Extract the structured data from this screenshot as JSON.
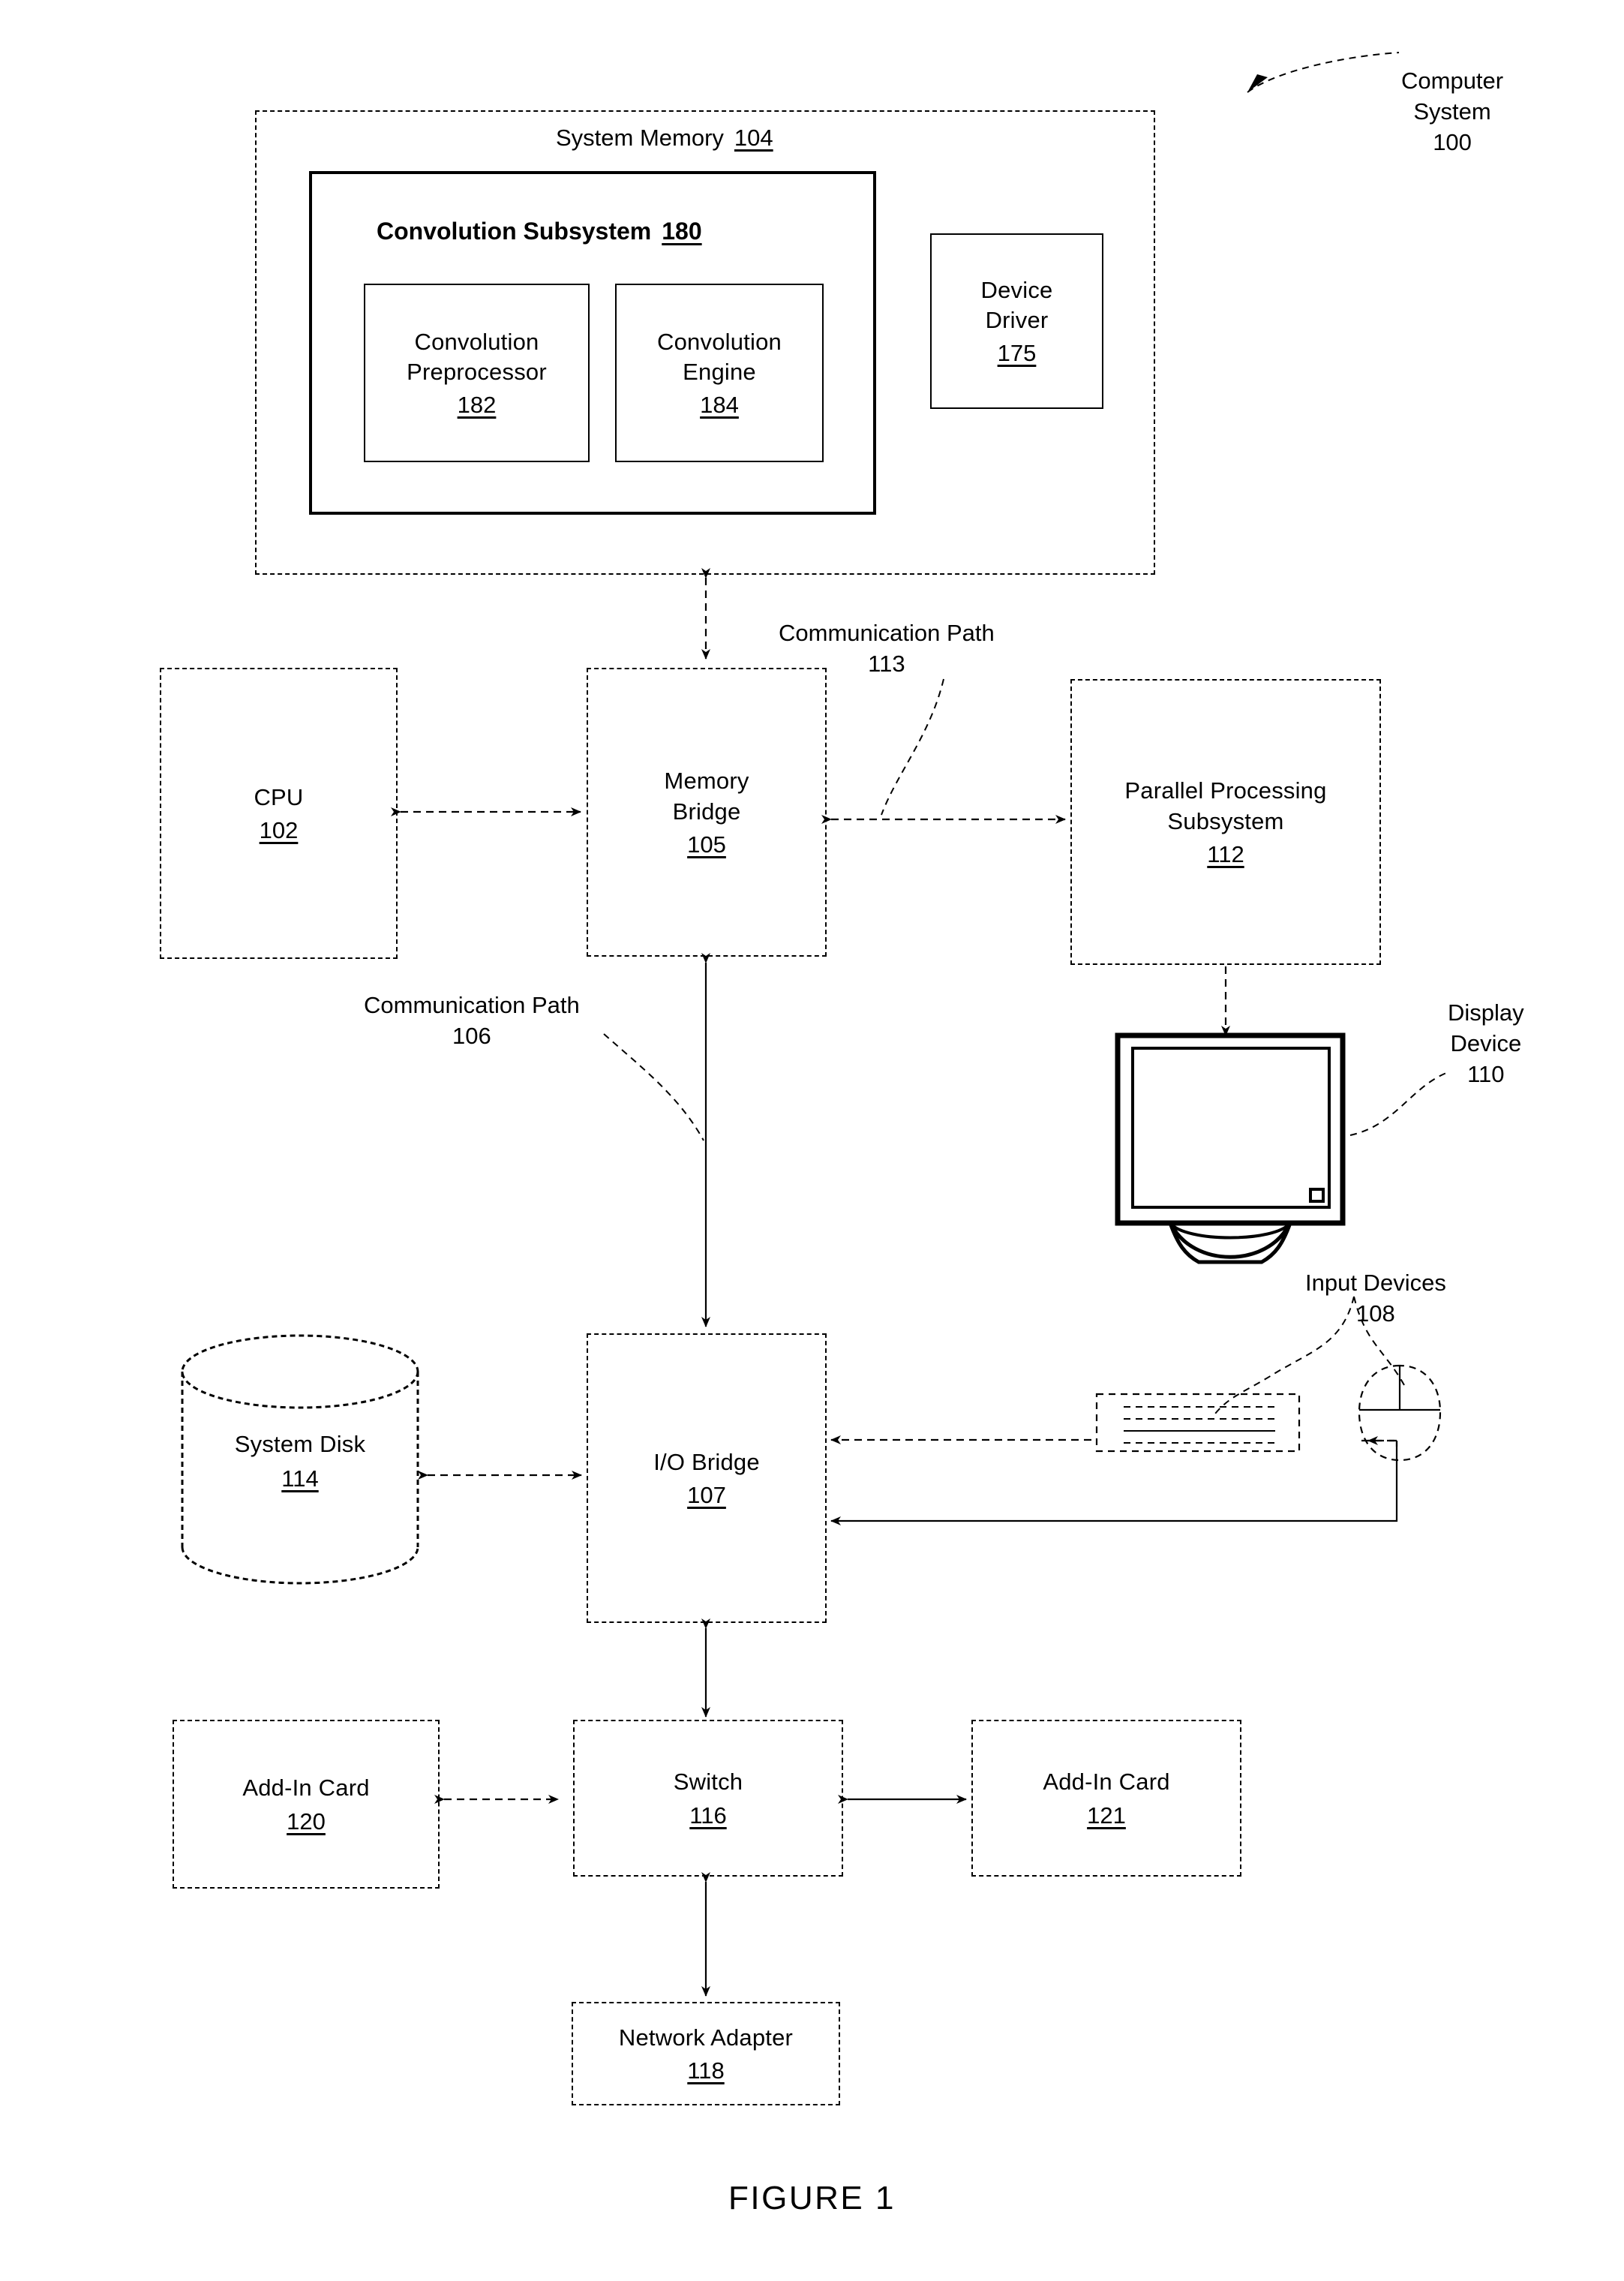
{
  "figure": {
    "caption": "FIGURE 1"
  },
  "callouts": {
    "computer_system": {
      "line1": "Computer",
      "line2": "System",
      "line3": "100"
    },
    "comm_path_113": {
      "line1": "Communication Path",
      "line2": "113"
    },
    "comm_path_106": {
      "line1": "Communication Path",
      "line2": "106"
    },
    "display_device": {
      "line1": "Display",
      "line2": "Device",
      "line3": "110"
    },
    "input_devices": {
      "line1": "Input Devices",
      "line2": "108"
    }
  },
  "system_memory": {
    "title": "System Memory",
    "number": "104",
    "convolution_subsystem": {
      "title": "Convolution Subsystem",
      "number": "180",
      "modules": [
        {
          "line1": "Convolution",
          "line2": "Preprocessor",
          "number": "182"
        },
        {
          "line1": "Convolution",
          "line2": "Engine",
          "number": "184"
        }
      ]
    },
    "device_driver": {
      "line1": "Device",
      "line2": "Driver",
      "number": "175"
    }
  },
  "blocks": {
    "cpu": {
      "label": "CPU",
      "number": "102"
    },
    "memory_bridge": {
      "line1": "Memory",
      "line2": "Bridge",
      "number": "105"
    },
    "parallel_processing_subsystem": {
      "line1": "Parallel Processing",
      "line2": "Subsystem",
      "number": "112"
    },
    "system_disk": {
      "label": "System Disk",
      "number": "114"
    },
    "io_bridge": {
      "label": "I/O Bridge",
      "number": "107"
    },
    "add_in_card_120": {
      "label": "Add-In Card",
      "number": "120"
    },
    "switch": {
      "label": "Switch",
      "number": "116"
    },
    "add_in_card_121": {
      "label": "Add-In Card",
      "number": "121"
    },
    "network_adapter": {
      "label": "Network Adapter",
      "number": "118"
    }
  },
  "icons": {
    "monitor": "display-monitor-icon",
    "keyboard": "keyboard-icon",
    "mouse": "mouse-icon",
    "disk": "cylinder-disk-icon"
  },
  "colors": {
    "ink": "#000000",
    "paper": "#ffffff"
  }
}
